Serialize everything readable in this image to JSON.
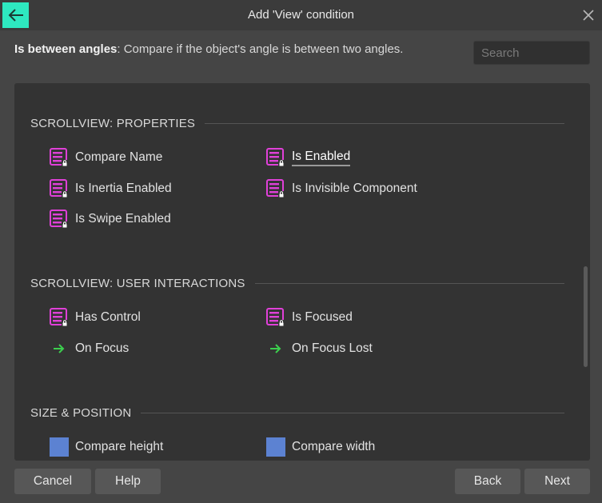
{
  "window": {
    "title": "Add 'View' condition"
  },
  "description": {
    "name": "Is between angles",
    "text": ": Compare if the object's angle is between two angles."
  },
  "search": {
    "placeholder": "Search",
    "value": ""
  },
  "sections": [
    {
      "title": "SCROLLVIEW: PROPERTIES",
      "items": [
        {
          "label": "Compare Name",
          "icon": "property-list-icon"
        },
        {
          "label": "Is Enabled",
          "icon": "property-list-icon",
          "selected": true
        },
        {
          "label": "Is Inertia Enabled",
          "icon": "property-list-icon"
        },
        {
          "label": "Is Invisible Component",
          "icon": "property-list-icon"
        },
        {
          "label": "Is Swipe Enabled",
          "icon": "property-list-icon"
        }
      ]
    },
    {
      "title": "SCROLLVIEW: USER INTERACTIONS",
      "items": [
        {
          "label": "Has Control",
          "icon": "property-list-icon"
        },
        {
          "label": "Is Focused",
          "icon": "property-list-icon"
        },
        {
          "label": "On Focus",
          "icon": "green-arrow-icon"
        },
        {
          "label": "On Focus Lost",
          "icon": "green-arrow-icon"
        }
      ]
    },
    {
      "title": "SIZE & POSITION",
      "items": [
        {
          "label": "Compare height",
          "icon": "blue-square-icon"
        },
        {
          "label": "Compare width",
          "icon": "blue-square-icon"
        }
      ]
    }
  ],
  "buttons": {
    "cancel": "Cancel",
    "help": "Help",
    "back": "Back",
    "next": "Next"
  },
  "colors": {
    "accent": "#2ee8c0",
    "property_icon": "#e040d8",
    "arrow_icon": "#3ccf4e",
    "size_icon": "#5c82d2"
  }
}
